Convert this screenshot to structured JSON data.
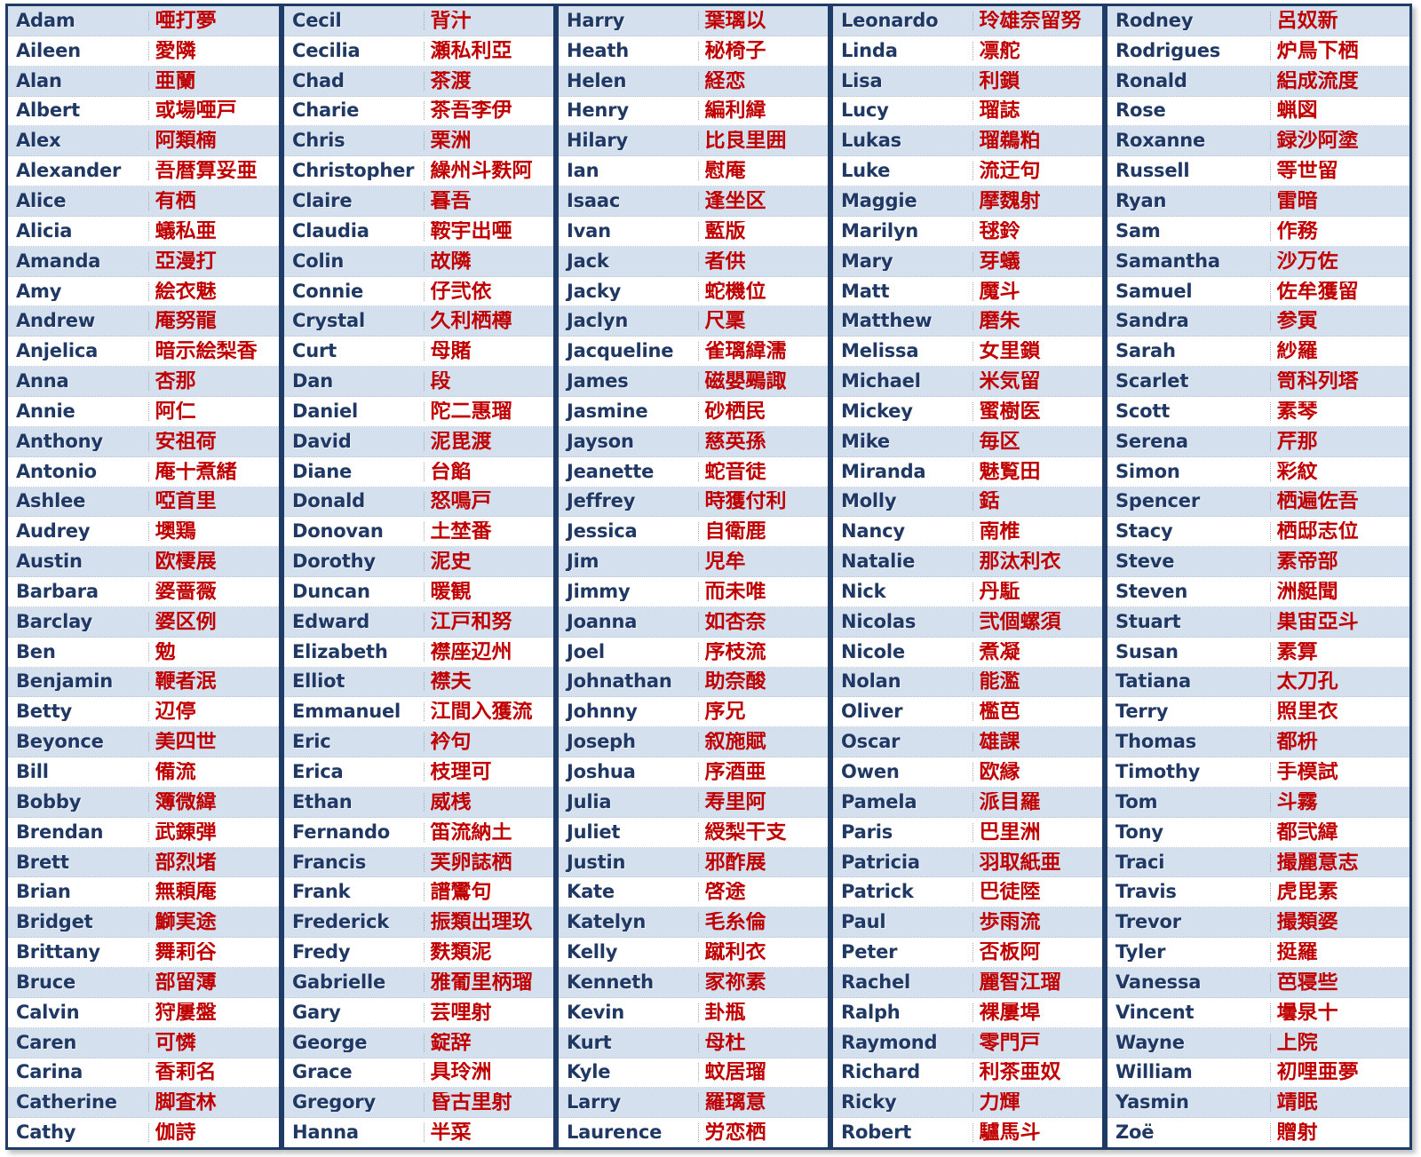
{
  "table": {
    "colors": {
      "english_text": "#1f3864",
      "japanese_text": "#c00000",
      "row_alt_background": "#d5e0ef",
      "row_background": "#ffffff",
      "border": "#1f3c66"
    },
    "columns": [
      {
        "id": "column-1",
        "rows": [
          {
            "en": "Adam",
            "jp": "唖打夢"
          },
          {
            "en": "Aileen",
            "jp": "愛隣"
          },
          {
            "en": "Alan",
            "jp": "亜蘭"
          },
          {
            "en": "Albert",
            "jp": "或場唖戸"
          },
          {
            "en": "Alex",
            "jp": "阿類楠"
          },
          {
            "en": "Alexander",
            "jp": "吾暦算妥亜"
          },
          {
            "en": "Alice",
            "jp": "有栖"
          },
          {
            "en": "Alicia",
            "jp": "蟻私亜"
          },
          {
            "en": "Amanda",
            "jp": "亞漫打"
          },
          {
            "en": "Amy",
            "jp": "絵衣魅"
          },
          {
            "en": "Andrew",
            "jp": "庵努龍"
          },
          {
            "en": "Anjelica",
            "jp": "暗示絵梨香"
          },
          {
            "en": "Anna",
            "jp": "杏那"
          },
          {
            "en": "Annie",
            "jp": "阿仁"
          },
          {
            "en": "Anthony",
            "jp": "安祖荷"
          },
          {
            "en": "Antonio",
            "jp": "庵十煮緒"
          },
          {
            "en": "Ashlee",
            "jp": "啞首里"
          },
          {
            "en": "Audrey",
            "jp": "墺鶏"
          },
          {
            "en": "Austin",
            "jp": "欧棲展"
          },
          {
            "en": "Barbara",
            "jp": "婆蔷薇"
          },
          {
            "en": "Barclay",
            "jp": "婆区例"
          },
          {
            "en": "Ben",
            "jp": "勉"
          },
          {
            "en": "Benjamin",
            "jp": "鞭者泯"
          },
          {
            "en": "Betty",
            "jp": "辺停"
          },
          {
            "en": "Beyonce",
            "jp": "美四世"
          },
          {
            "en": "Bill",
            "jp": "備流"
          },
          {
            "en": "Bobby",
            "jp": "簿微緯"
          },
          {
            "en": "Brendan",
            "jp": "武錬弾"
          },
          {
            "en": "Brett",
            "jp": "部烈堵"
          },
          {
            "en": "Brian",
            "jp": "無頼庵"
          },
          {
            "en": "Bridget",
            "jp": "鰤実途"
          },
          {
            "en": "Brittany",
            "jp": "舞莉谷"
          },
          {
            "en": "Bruce",
            "jp": "部留薄"
          },
          {
            "en": "Calvin",
            "jp": "狩屢盤"
          },
          {
            "en": "Caren",
            "jp": "可憐"
          },
          {
            "en": "Carina",
            "jp": "香莉名"
          },
          {
            "en": "Catherine",
            "jp": "脚査林"
          },
          {
            "en": "Cathy",
            "jp": "伽詩"
          }
        ]
      },
      {
        "id": "column-2",
        "rows": [
          {
            "en": "Cecil",
            "jp": "背汁"
          },
          {
            "en": "Cecilia",
            "jp": "瀬私利亞"
          },
          {
            "en": "Chad",
            "jp": "茶渡"
          },
          {
            "en": "Charie",
            "jp": "茶吾李伊"
          },
          {
            "en": "Chris",
            "jp": "栗洲"
          },
          {
            "en": "Christopher",
            "jp": "繰州斗麩阿"
          },
          {
            "en": "Claire",
            "jp": "暮吾"
          },
          {
            "en": "Claudia",
            "jp": "鞍宇出唖"
          },
          {
            "en": "Colin",
            "jp": "故隣"
          },
          {
            "en": "Connie",
            "jp": "仔弐依"
          },
          {
            "en": "Crystal",
            "jp": "久利栖樽"
          },
          {
            "en": "Curt",
            "jp": "母賭"
          },
          {
            "en": "Dan",
            "jp": "段"
          },
          {
            "en": "Daniel",
            "jp": "陀二惠瑠"
          },
          {
            "en": "David",
            "jp": "泥毘渡"
          },
          {
            "en": "Diane",
            "jp": "台餡"
          },
          {
            "en": "Donald",
            "jp": "怒鳴戸"
          },
          {
            "en": "Donovan",
            "jp": "土埜番"
          },
          {
            "en": "Dorothy",
            "jp": "泥史"
          },
          {
            "en": "Duncan",
            "jp": "暖観"
          },
          {
            "en": "Edward",
            "jp": "江戸和努"
          },
          {
            "en": "Elizabeth",
            "jp": "襟座辺州"
          },
          {
            "en": "Elliot",
            "jp": "襟夫"
          },
          {
            "en": "Emmanuel",
            "jp": "江間入獲流"
          },
          {
            "en": "Eric",
            "jp": "衿句"
          },
          {
            "en": "Erica",
            "jp": "枝理可"
          },
          {
            "en": "Ethan",
            "jp": "威桟"
          },
          {
            "en": "Fernando",
            "jp": "笛流納土"
          },
          {
            "en": "Francis",
            "jp": "芙卵誌栖"
          },
          {
            "en": "Frank",
            "jp": "譜鸞句"
          },
          {
            "en": "Frederick",
            "jp": "振類出理玖"
          },
          {
            "en": "Fredy",
            "jp": "麩類泥"
          },
          {
            "en": "Gabrielle",
            "jp": "雅葡里柄瑠"
          },
          {
            "en": "Gary",
            "jp": "芸哩射"
          },
          {
            "en": "George",
            "jp": "錠辞"
          },
          {
            "en": "Grace",
            "jp": "具玲洲"
          },
          {
            "en": "Gregory",
            "jp": "昏古里射"
          },
          {
            "en": "Hanna",
            "jp": "半菜"
          }
        ]
      },
      {
        "id": "column-3",
        "rows": [
          {
            "en": "Harry",
            "jp": "葉璃以"
          },
          {
            "en": "Heath",
            "jp": "秘椅子"
          },
          {
            "en": "Helen",
            "jp": "経恋"
          },
          {
            "en": "Henry",
            "jp": "編利緯"
          },
          {
            "en": "Hilary",
            "jp": "比良里囲"
          },
          {
            "en": "Ian",
            "jp": "慰庵"
          },
          {
            "en": "Isaac",
            "jp": "逢坐区"
          },
          {
            "en": "Ivan",
            "jp": "藍版"
          },
          {
            "en": "Jack",
            "jp": "者供"
          },
          {
            "en": "Jacky",
            "jp": "蛇機位"
          },
          {
            "en": "Jaclyn",
            "jp": "尺稟"
          },
          {
            "en": "Jacqueline",
            "jp": "雀璃緯濡"
          },
          {
            "en": "James",
            "jp": "磁嬰鵐諏"
          },
          {
            "en": "Jasmine",
            "jp": "砂栖民"
          },
          {
            "en": "Jayson",
            "jp": "慈英孫"
          },
          {
            "en": "Jeanette",
            "jp": "蛇音徒"
          },
          {
            "en": "Jeffrey",
            "jp": "時獲付利"
          },
          {
            "en": "Jessica",
            "jp": "自衛鹿"
          },
          {
            "en": "Jim",
            "jp": "児牟"
          },
          {
            "en": "Jimmy",
            "jp": "而未唯"
          },
          {
            "en": "Joanna",
            "jp": "如杏奈"
          },
          {
            "en": "Joel",
            "jp": "序枝流"
          },
          {
            "en": "Johnathan",
            "jp": "助奈酸"
          },
          {
            "en": "Johnny",
            "jp": "序兄"
          },
          {
            "en": "Joseph",
            "jp": "叙施賦"
          },
          {
            "en": "Joshua",
            "jp": "序酒亜"
          },
          {
            "en": "Julia",
            "jp": "寿里阿"
          },
          {
            "en": "Juliet",
            "jp": "綬梨干支"
          },
          {
            "en": "Justin",
            "jp": "邪酢展"
          },
          {
            "en": "Kate",
            "jp": "啓途"
          },
          {
            "en": "Katelyn",
            "jp": "毛糸倫"
          },
          {
            "en": "Kelly",
            "jp": "蹴利衣"
          },
          {
            "en": "Kenneth",
            "jp": "家祢素"
          },
          {
            "en": "Kevin",
            "jp": "卦瓶"
          },
          {
            "en": "Kurt",
            "jp": "母杜"
          },
          {
            "en": "Kyle",
            "jp": "蚊居瑠"
          },
          {
            "en": "Larry",
            "jp": "羅璃意"
          },
          {
            "en": "Laurence",
            "jp": "労恋栖"
          }
        ]
      },
      {
        "id": "column-4",
        "rows": [
          {
            "en": "Leonardo",
            "jp": "玲雄奈留努"
          },
          {
            "en": "Linda",
            "jp": "凛舵"
          },
          {
            "en": "Lisa",
            "jp": "利鎖"
          },
          {
            "en": "Lucy",
            "jp": "瑠誌"
          },
          {
            "en": "Lukas",
            "jp": "瑠鵜粕"
          },
          {
            "en": "Luke",
            "jp": "流迂句"
          },
          {
            "en": "Maggie",
            "jp": "摩魏射"
          },
          {
            "en": "Marilyn",
            "jp": "毬鈴"
          },
          {
            "en": "Mary",
            "jp": "芽蟻"
          },
          {
            "en": "Matt",
            "jp": "魔斗"
          },
          {
            "en": "Matthew",
            "jp": "磨朱"
          },
          {
            "en": "Melissa",
            "jp": "女里鎖"
          },
          {
            "en": "Michael",
            "jp": "米気留"
          },
          {
            "en": "Mickey",
            "jp": "蜜樹医"
          },
          {
            "en": "Mike",
            "jp": "毎区"
          },
          {
            "en": "Miranda",
            "jp": "魅覧田"
          },
          {
            "en": "Molly",
            "jp": "銛"
          },
          {
            "en": "Nancy",
            "jp": "南椎"
          },
          {
            "en": "Natalie",
            "jp": "那汰利衣"
          },
          {
            "en": "Nick",
            "jp": "丹駈"
          },
          {
            "en": "Nicolas",
            "jp": "弐個螺須"
          },
          {
            "en": "Nicole",
            "jp": "煮凝"
          },
          {
            "en": "Nolan",
            "jp": "能濫"
          },
          {
            "en": "Oliver",
            "jp": "檻芭"
          },
          {
            "en": "Oscar",
            "jp": "雄課"
          },
          {
            "en": "Owen",
            "jp": "欧縁"
          },
          {
            "en": "Pamela",
            "jp": "派目羅"
          },
          {
            "en": "Paris",
            "jp": "巴里洲"
          },
          {
            "en": "Patricia",
            "jp": "羽取紙亜"
          },
          {
            "en": "Patrick",
            "jp": "巴徒陸"
          },
          {
            "en": "Paul",
            "jp": "歩雨流"
          },
          {
            "en": "Peter",
            "jp": "否板阿"
          },
          {
            "en": "Rachel",
            "jp": "麗智江瑠"
          },
          {
            "en": "Ralph",
            "jp": "裸屢埠"
          },
          {
            "en": "Raymond",
            "jp": "零門戸"
          },
          {
            "en": "Richard",
            "jp": "利茶亜奴"
          },
          {
            "en": "Ricky",
            "jp": "力輝"
          },
          {
            "en": "Robert",
            "jp": "驢馬斗"
          }
        ]
      },
      {
        "id": "column-5",
        "rows": [
          {
            "en": "Rodney",
            "jp": "呂奴新"
          },
          {
            "en": "Rodrigues",
            "jp": "炉鳥下栖"
          },
          {
            "en": "Ronald",
            "jp": "絽成流度"
          },
          {
            "en": "Rose",
            "jp": "蝋図"
          },
          {
            "en": "Roxanne",
            "jp": "録沙阿塗"
          },
          {
            "en": "Russell",
            "jp": "等世留"
          },
          {
            "en": "Ryan",
            "jp": "雷暗"
          },
          {
            "en": "Sam",
            "jp": "作務"
          },
          {
            "en": "Samantha",
            "jp": "沙万佐"
          },
          {
            "en": "Samuel",
            "jp": "佐牟獲留"
          },
          {
            "en": "Sandra",
            "jp": "参寅"
          },
          {
            "en": "Sarah",
            "jp": "紗羅"
          },
          {
            "en": "Scarlet",
            "jp": "笥科列塔"
          },
          {
            "en": "Scott",
            "jp": "素琴"
          },
          {
            "en": "Serena",
            "jp": "芹那"
          },
          {
            "en": "Simon",
            "jp": "彩紋"
          },
          {
            "en": "Spencer",
            "jp": "栖遍佐吾"
          },
          {
            "en": "Stacy",
            "jp": "栖邸志位"
          },
          {
            "en": "Steve",
            "jp": "素帝部"
          },
          {
            "en": "Steven",
            "jp": "洲艇聞"
          },
          {
            "en": "Stuart",
            "jp": "巣宙亞斗"
          },
          {
            "en": "Susan",
            "jp": "素算"
          },
          {
            "en": "Tatiana",
            "jp": "太刀孔"
          },
          {
            "en": "Terry",
            "jp": "照里衣"
          },
          {
            "en": "Thomas",
            "jp": "都枡"
          },
          {
            "en": "Timothy",
            "jp": "手模試"
          },
          {
            "en": "Tom",
            "jp": "斗霧"
          },
          {
            "en": "Tony",
            "jp": "都弐緯"
          },
          {
            "en": "Traci",
            "jp": "撮麗意志"
          },
          {
            "en": "Travis",
            "jp": "虎毘素"
          },
          {
            "en": "Trevor",
            "jp": "撮類婆"
          },
          {
            "en": "Tyler",
            "jp": "挺羅"
          },
          {
            "en": "Vanessa",
            "jp": "芭寝些"
          },
          {
            "en": "Vincent",
            "jp": "壜泉十"
          },
          {
            "en": "Wayne",
            "jp": "上院"
          },
          {
            "en": "William",
            "jp": "初哩亜夢"
          },
          {
            "en": "Yasmin",
            "jp": "靖眠"
          },
          {
            "en": "Zoë",
            "jp": "贈射"
          }
        ]
      }
    ]
  }
}
